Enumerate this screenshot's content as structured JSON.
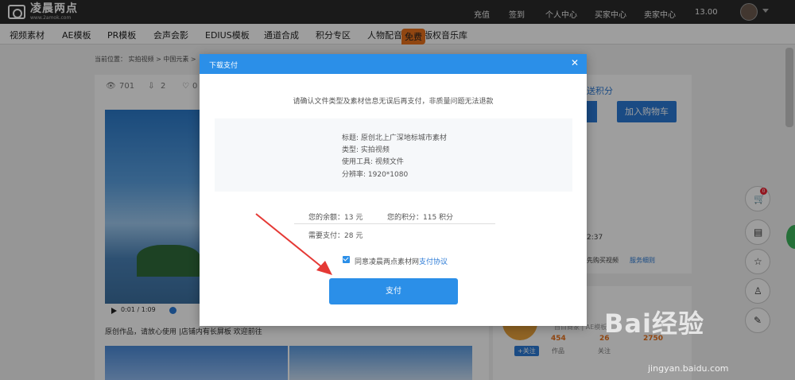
{
  "topbar": {
    "brand": "凌晨两点",
    "url": "www.2amok.com",
    "links": [
      "充值",
      "签到",
      "个人中心",
      "买家中心",
      "卖家中心"
    ],
    "balance": "13.00"
  },
  "nav": {
    "items": [
      "视频素材",
      "AE模板",
      "PR模板",
      "会声会影",
      "EDIUS模板",
      "通道合成",
      "积分专区",
      "人物配音",
      "版权音乐库"
    ],
    "free_badge": "免费"
  },
  "breadcrumb": "当前位置： 实拍视频 > 中国元素 >",
  "stats": {
    "views": "701",
    "downloads": "2",
    "likes": "0"
  },
  "video": {
    "time": "0:01 / 1:09"
  },
  "description": "原创作品，请放心使用 |店铺内有长屏板 欢迎前往",
  "right": {
    "points_link": "送积分",
    "cart_button": "加入购物车",
    "time_text": "2:37",
    "buy_hint": "先购买视频",
    "service_rule": "服务细则",
    "author_tag": "自白商家 | AE模板",
    "follow": "+关注",
    "works_count": "454",
    "works_label": "作品",
    "follow_count": "26",
    "follow_label": "关注",
    "fans_count": "2750"
  },
  "modal": {
    "title": "下载支付",
    "notice": "请确认文件类型及素材信息无误后再支付，非质量问题无法退款",
    "info": [
      "标题: 原创北上广深地标城市素材",
      "类型: 实拍视频",
      "使用工具: 视频文件",
      "分辨率: 1920*1080"
    ],
    "balance_text": "您的余额：13 元",
    "points_text": "您的积分：115 积分",
    "need_pay": "需要支付：28 元",
    "agree_text": "同意凌晨两点素材网",
    "agree_link": "支付协议",
    "pay_button": "支付"
  },
  "floating": {
    "cart_badge": "0"
  },
  "watermark": {
    "text": "Bai经验",
    "sub": "jingyan.baidu.com"
  },
  "colors": {
    "accent": "#2b8fe8",
    "topbar": "#2b2b2b",
    "badge": "#e8721c",
    "arrow": "#e53935"
  }
}
